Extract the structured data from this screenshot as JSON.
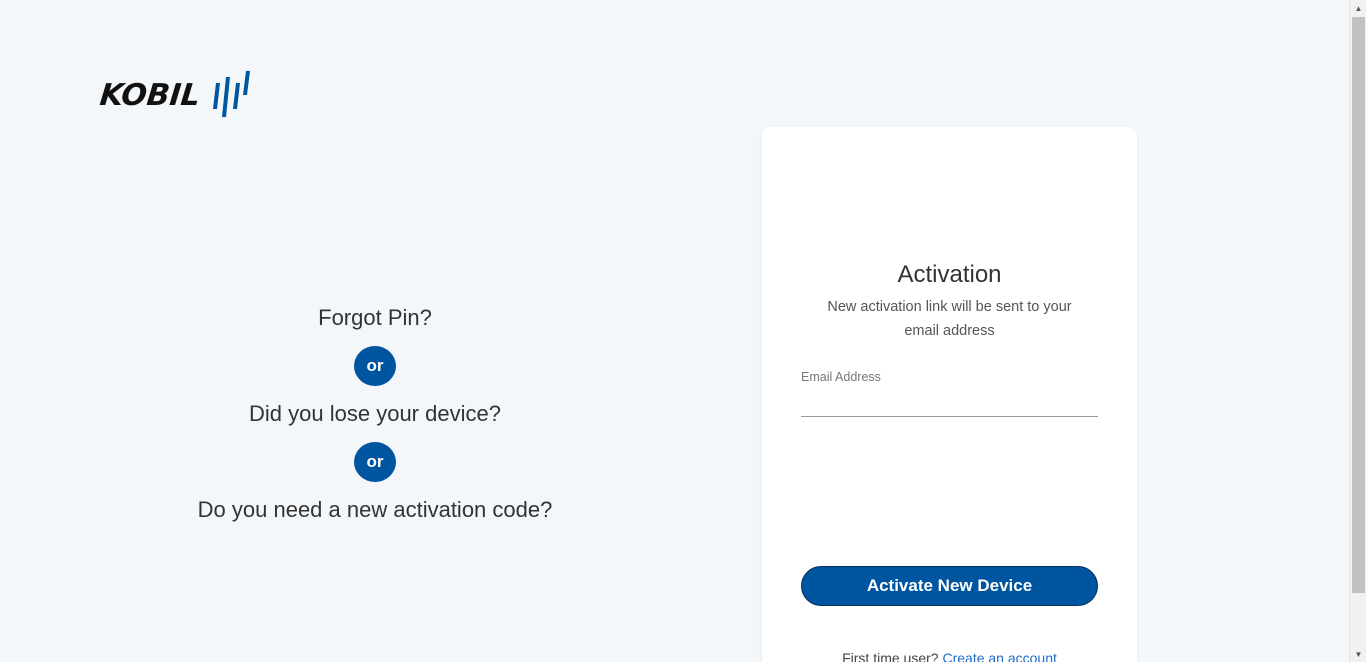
{
  "logo": {
    "text": "KOBIL",
    "mark_color": "#0055a0"
  },
  "left": {
    "question_1": "Forgot Pin?",
    "or_1": "or",
    "question_2": "Did you lose your device?",
    "or_2": "or",
    "question_3": "Do you need a new activation code?"
  },
  "card": {
    "title": "Activation",
    "subtitle": "New activation link will be sent to your email address",
    "email_label": "Email Address",
    "email_value": "",
    "button_label": "Activate New Device",
    "first_time_text": "First time user?",
    "create_account_link": "Create an account"
  },
  "colors": {
    "accent": "#0055a0",
    "background": "#f3f7fa",
    "link": "#1f6bc7"
  }
}
